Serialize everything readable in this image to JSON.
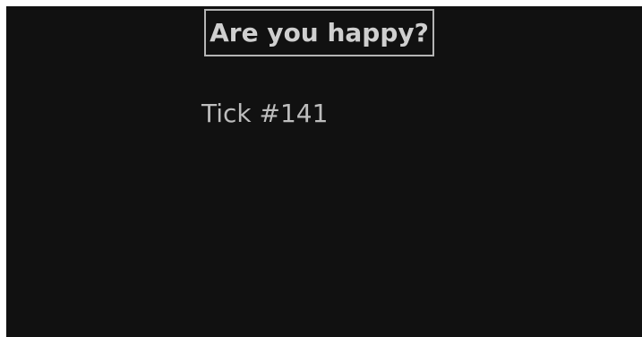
{
  "dialog": {
    "button_label": "Are you happy?",
    "tick_text": "Tick #141"
  },
  "colors": {
    "background": "#111111",
    "text": "#cfcfcf",
    "border": "#b5b5b5"
  }
}
